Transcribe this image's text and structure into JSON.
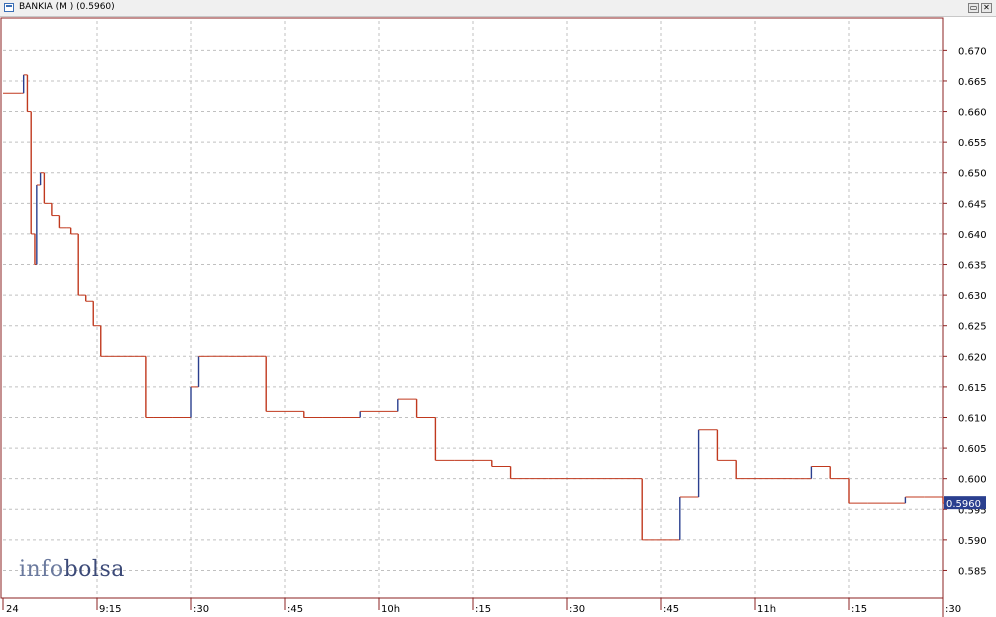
{
  "window": {
    "title": "BANKIA (M ) (0.5960)",
    "restore_label": "▭",
    "close_label": "✕"
  },
  "logo": {
    "part1": "info",
    "part2": "bolsa"
  },
  "colors": {
    "down": "#c0391e",
    "up": "#2a3f8f",
    "grid": "#c0c0c0",
    "axis": "#8b2020",
    "price_tag_bg": "#2a3f8f"
  },
  "chart_data": {
    "type": "line",
    "title": "BANKIA (M ) (0.5960)",
    "xlabel": "",
    "ylabel": "",
    "ylim": [
      0.5805,
      0.6748
    ],
    "xlim": [
      9.0,
      11.5
    ],
    "yticks": [
      "0.670",
      "0.665",
      "0.660",
      "0.655",
      "0.650",
      "0.645",
      "0.640",
      "0.635",
      "0.630",
      "0.625",
      "0.620",
      "0.615",
      "0.610",
      "0.605",
      "0.600",
      "0.595",
      "0.590",
      "0.585"
    ],
    "xticks": [
      {
        "x": 9.0,
        "label": "24"
      },
      {
        "x": 9.25,
        "label": "9:15"
      },
      {
        "x": 9.5,
        "label": ":30"
      },
      {
        "x": 9.75,
        "label": ":45"
      },
      {
        "x": 10.0,
        "label": "10h"
      },
      {
        "x": 10.25,
        "label": ":15"
      },
      {
        "x": 10.5,
        "label": ":30"
      },
      {
        "x": 10.75,
        "label": ":45"
      },
      {
        "x": 11.0,
        "label": "11h"
      },
      {
        "x": 11.25,
        "label": ":15"
      },
      {
        "x": 11.5,
        "label": ":30"
      }
    ],
    "last_price": "0.5960",
    "grid": true,
    "series": [
      {
        "x": [
          9.0,
          9.05,
          9.055,
          9.065,
          9.075,
          9.085,
          9.09,
          9.1,
          9.11,
          9.13,
          9.15,
          9.17,
          9.18,
          9.2,
          9.22,
          9.24,
          9.26,
          9.27,
          9.29,
          9.32,
          9.33,
          9.35,
          9.38,
          9.4,
          9.45,
          9.48,
          9.5,
          9.52,
          9.55,
          9.6,
          9.62,
          9.65,
          9.7,
          9.8,
          9.85,
          9.9,
          9.95,
          10.0,
          10.05,
          10.1,
          10.15,
          10.2,
          10.25,
          10.3,
          10.35,
          10.4,
          10.45,
          10.5,
          10.55,
          10.6,
          10.65,
          10.7,
          10.75,
          10.8,
          10.85,
          10.9,
          10.95,
          11.0,
          11.05,
          11.1,
          11.12,
          11.15,
          11.2,
          11.25,
          11.3,
          11.35,
          11.4,
          11.45,
          11.5
        ],
        "y": [
          0.663,
          0.663,
          0.666,
          0.66,
          0.64,
          0.635,
          0.648,
          0.65,
          0.645,
          0.643,
          0.641,
          0.641,
          0.64,
          0.63,
          0.629,
          0.625,
          0.62,
          0.62,
          0.62,
          0.62,
          0.62,
          0.62,
          0.61,
          0.61,
          0.61,
          0.61,
          0.615,
          0.62,
          0.62,
          0.62,
          0.62,
          0.62,
          0.611,
          0.61,
          0.61,
          0.61,
          0.611,
          0.611,
          0.613,
          0.61,
          0.603,
          0.603,
          0.603,
          0.602,
          0.6,
          0.6,
          0.6,
          0.6,
          0.6,
          0.6,
          0.6,
          0.59,
          0.59,
          0.597,
          0.608,
          0.603,
          0.6,
          0.6,
          0.6,
          0.6,
          0.6,
          0.602,
          0.6,
          0.596,
          0.596,
          0.596,
          0.597,
          0.597,
          0.596
        ]
      }
    ]
  }
}
